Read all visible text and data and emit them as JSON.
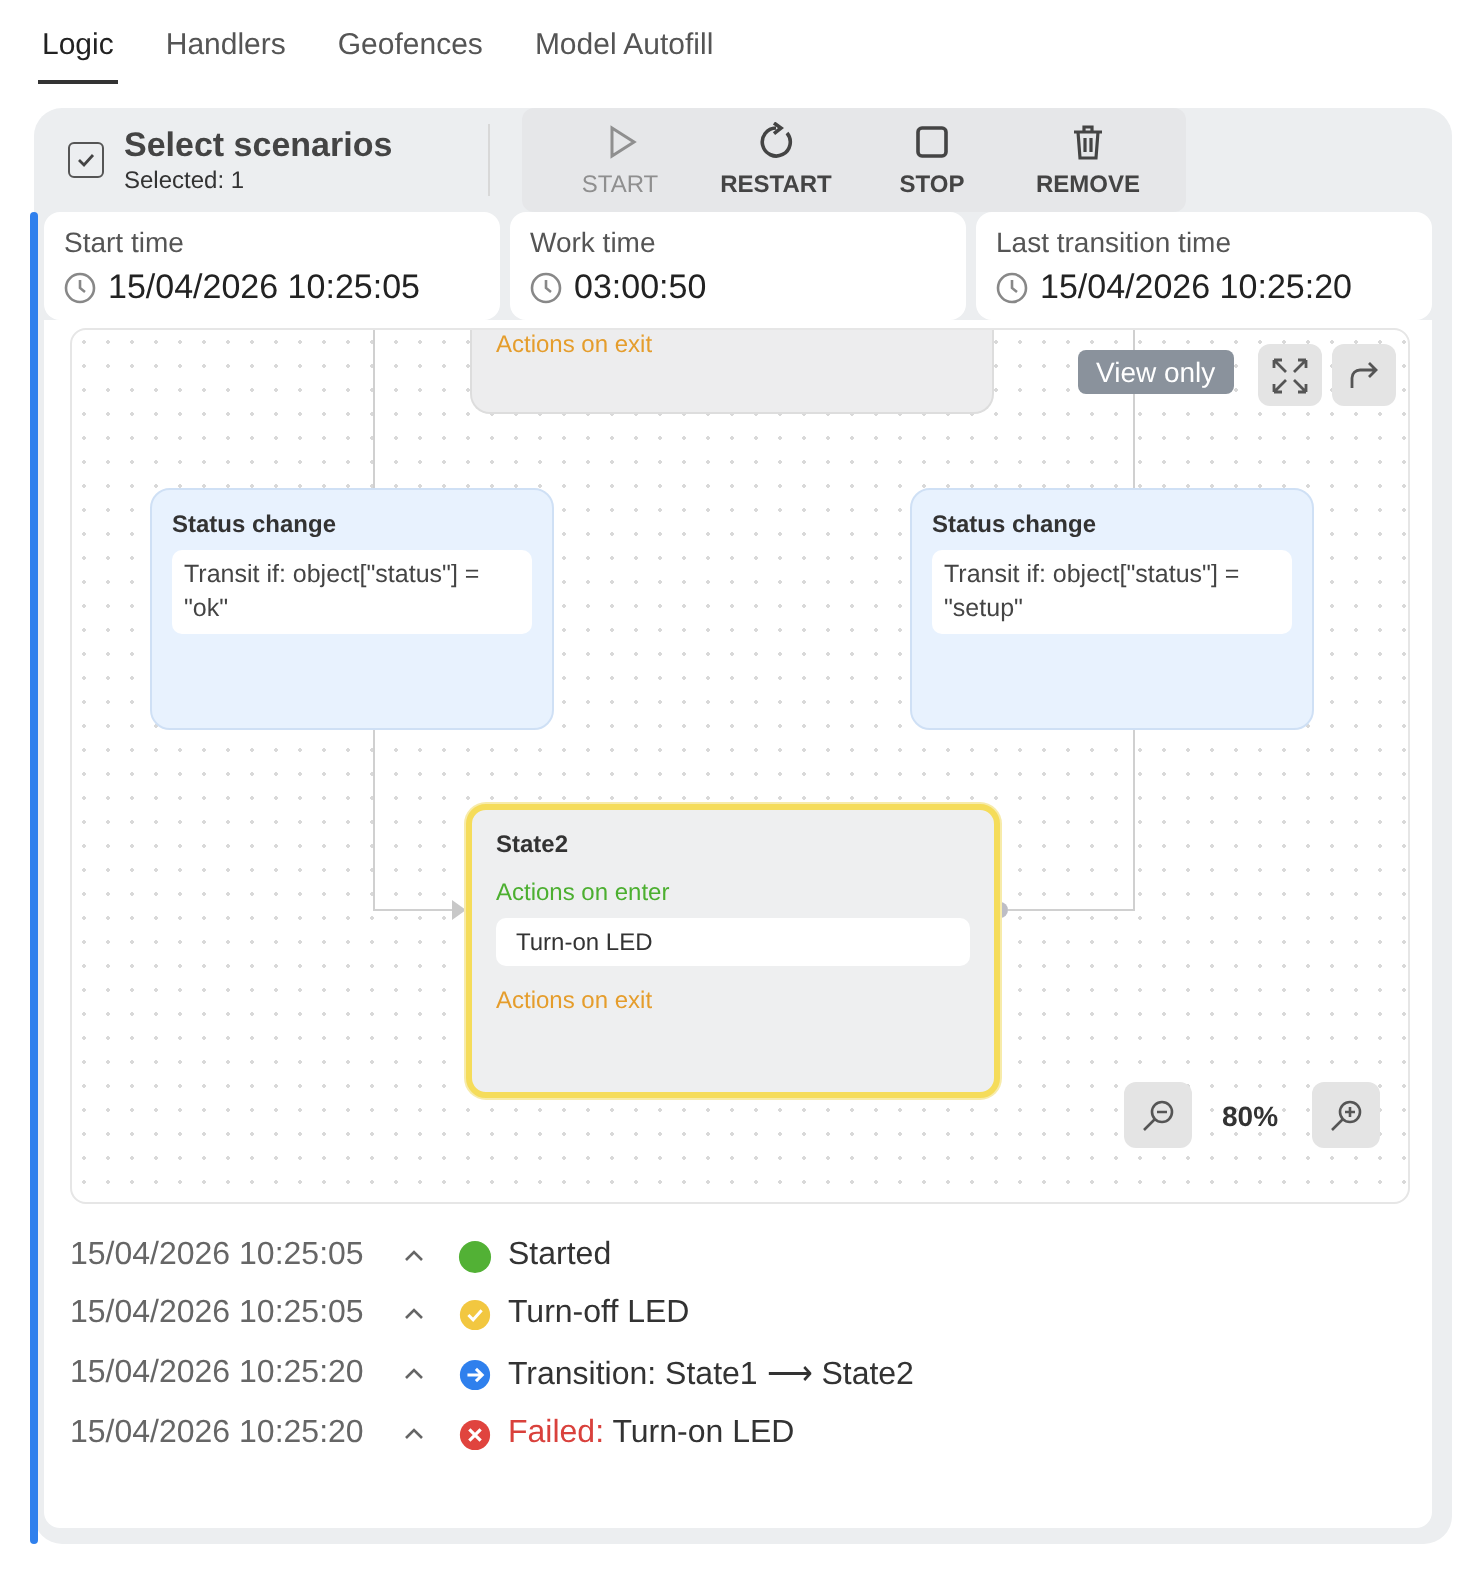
{
  "tabs": [
    {
      "label": "Logic",
      "selected": true
    },
    {
      "label": "Handlers",
      "selected": false
    },
    {
      "label": "Geofences",
      "selected": false
    },
    {
      "label": "Model Autofill",
      "selected": false
    }
  ],
  "toolbar": {
    "select": {
      "title": "Select scenarios",
      "subtitle": "Selected: 1",
      "checked": true
    },
    "buttons": [
      {
        "kind": "start",
        "label": "START",
        "disabled": true
      },
      {
        "kind": "restart",
        "label": "RESTART",
        "disabled": false
      },
      {
        "kind": "stop",
        "label": "STOP",
        "disabled": false
      },
      {
        "kind": "remove",
        "label": "REMOVE",
        "disabled": false
      }
    ]
  },
  "info": [
    {
      "label": "Start time",
      "value": "15/04/2026 10:25:05"
    },
    {
      "label": "Work time",
      "value": "03:00:50"
    },
    {
      "label": "Last transition time",
      "value": "15/04/2026 10:25:20"
    }
  ],
  "diagram": {
    "badge": "View only",
    "zoom": "80%",
    "top_state": {
      "exit_label": "Actions on exit"
    },
    "transitions": [
      {
        "title": "Status change",
        "condition": "Transit if: object[\"status\"] = \"ok\""
      },
      {
        "title": "Status change",
        "condition": "Transit if: object[\"status\"] = \"setup\""
      }
    ],
    "active_state": {
      "title": "State2",
      "enter_label": "Actions on enter",
      "action": "Turn-on LED",
      "exit_label": "Actions on exit",
      "selected": true
    }
  },
  "log": [
    {
      "time": "15/04/2026 10:25:05",
      "kind": "started",
      "text": "Started"
    },
    {
      "time": "15/04/2026 10:25:05",
      "kind": "done",
      "text": "Turn-off LED"
    },
    {
      "time": "15/04/2026 10:25:20",
      "kind": "transition",
      "text": "Transition: State1 ⟶ State2"
    },
    {
      "time": "15/04/2026 10:25:20",
      "kind": "failed",
      "prefix": "Failed:",
      "text": "Turn-on LED"
    }
  ]
}
